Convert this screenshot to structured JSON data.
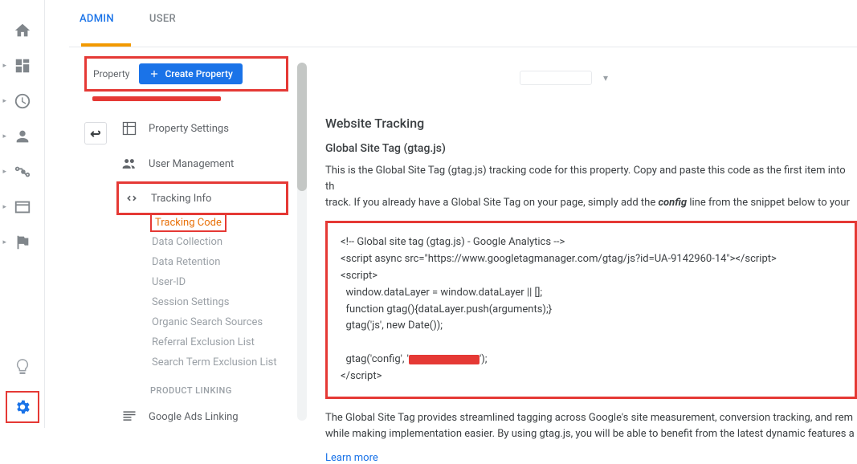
{
  "tabs": {
    "admin": "ADMIN",
    "user": "USER"
  },
  "property": {
    "label": "Property",
    "create_btn": "Create Property"
  },
  "nav": {
    "property_settings": "Property Settings",
    "user_management": "User Management",
    "tracking_info": "Tracking Info",
    "sub": {
      "tracking_code": "Tracking Code",
      "data_collection": "Data Collection",
      "data_retention": "Data Retention",
      "user_id": "User-ID",
      "session_settings": "Session Settings",
      "organic_search": "Organic Search Sources",
      "referral_exclusion": "Referral Exclusion List",
      "search_term_exclusion": "Search Term Exclusion List"
    },
    "product_linking_label": "PRODUCT LINKING",
    "google_ads_linking": "Google Ads Linking"
  },
  "main": {
    "h2": "Website Tracking",
    "h3": "Global Site Tag (gtag.js)",
    "desc1a": "This is the Global Site Tag (gtag.js) tracking code for this property. Copy and paste this code as the first item into th",
    "desc1b": "track. If you already have a Global Site Tag on your page, simply add the ",
    "desc1c": "config",
    "desc1d": " line from the snippet below to your ",
    "code": {
      "l1": "<!-- Global site tag (gtag.js) - Google Analytics -->",
      "l2": "<script async src=\"https://www.googletagmanager.com/gtag/js?id=UA-9142960-14\"></script>",
      "l3": "<script>",
      "l4": "  window.dataLayer = window.dataLayer || [];",
      "l5": "  function gtag(){dataLayer.push(arguments);}",
      "l6": "  gtag('js', new Date());",
      "l7": "",
      "l8a": "  gtag('config', '",
      "l8b": "');",
      "l9": "</script>"
    },
    "desc2": "The Global Site Tag provides streamlined tagging across Google's site measurement, conversion tracking, and rem",
    "desc3": "while making implementation easier. By using gtag.js, you will be able to benefit from the latest dynamic features a",
    "learn_more": "Learn more"
  }
}
